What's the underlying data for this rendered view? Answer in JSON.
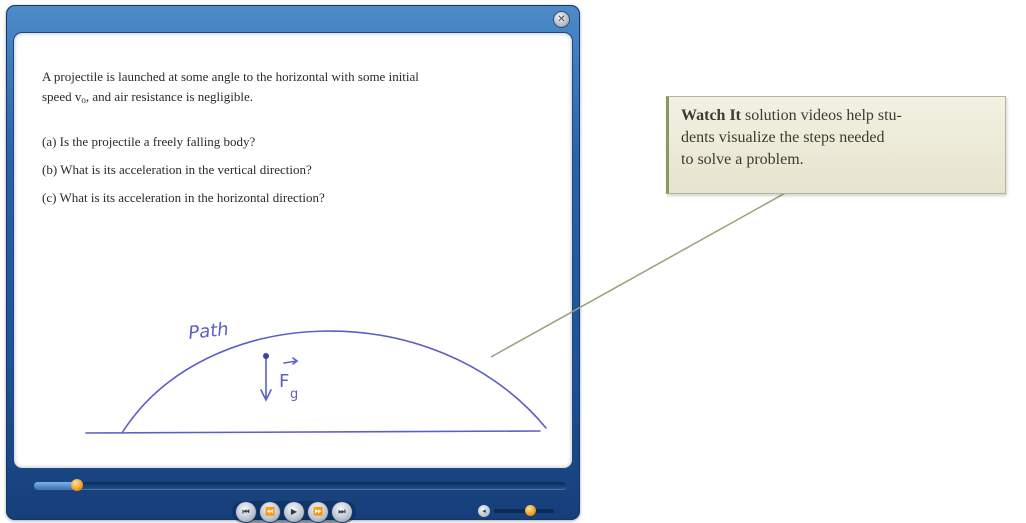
{
  "player": {
    "close_icon": "close-icon",
    "question": {
      "intro_line1": "A projectile is launched at some angle to the horizontal with some initial",
      "intro_line2_a": "speed v",
      "intro_line2_sub": "o",
      "intro_line2_b": ", and air resistance is negligible.",
      "parts": [
        "(a) Is the projectile a freely falling body?",
        "(b) What is its acceleration in the vertical direction?",
        "(c) What is its acceleration in the horizontal direction?"
      ]
    },
    "drawing": {
      "path_label": "Path",
      "force_label": "F",
      "force_subscript": "g",
      "ink_color": "#5b5fc7"
    },
    "seek_progress": 0.08,
    "volume_level": 0.6,
    "controls": [
      {
        "name": "skip-back-button",
        "icon": "skip-back-icon",
        "glyph": "⏮"
      },
      {
        "name": "rewind-button",
        "icon": "rewind-icon",
        "glyph": "⏪"
      },
      {
        "name": "play-button",
        "icon": "play-icon",
        "glyph": "▶"
      },
      {
        "name": "fast-forward-button",
        "icon": "fast-forward-icon",
        "glyph": "⏩"
      },
      {
        "name": "skip-forward-button",
        "icon": "skip-forward-icon",
        "glyph": "⏭"
      }
    ],
    "colors": {
      "frame": "#2a63a6",
      "knob": "#f39a1f"
    }
  },
  "callout": {
    "bold": "Watch It",
    "line1_rest": " solution videos help stu-",
    "line2": "dents visualize the steps needed",
    "line3": "to solve a problem.",
    "color": "#e8e6d0"
  }
}
